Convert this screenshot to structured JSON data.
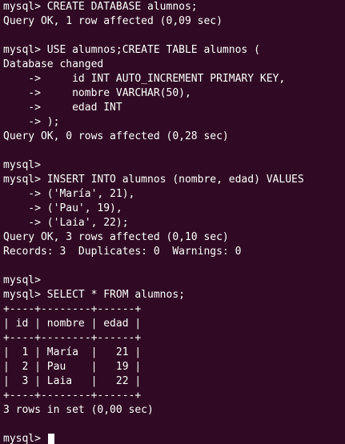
{
  "terminal": {
    "lines": [
      "mysql> CREATE DATABASE alumnos;",
      "Query OK, 1 row affected (0,09 sec)",
      "",
      "mysql> USE alumnos;CREATE TABLE alumnos (",
      "Database changed",
      "    ->     id INT AUTO_INCREMENT PRIMARY KEY,",
      "    ->     nombre VARCHAR(50),",
      "    ->     edad INT",
      "    -> );",
      "Query OK, 0 rows affected (0,28 sec)",
      "",
      "mysql>",
      "mysql> INSERT INTO alumnos (nombre, edad) VALUES",
      "    -> ('María', 21),",
      "    -> ('Pau', 19),",
      "    -> ('Laia', 22);",
      "Query OK, 3 rows affected (0,10 sec)",
      "Records: 3  Duplicates: 0  Warnings: 0",
      "",
      "mysql>",
      "mysql> SELECT * FROM alumnos;",
      "+----+--------+------+",
      "| id | nombre | edad |",
      "+----+--------+------+",
      "|  1 | María  |   21 |",
      "|  2 | Pau    |   19 |",
      "|  3 | Laia   |   22 |",
      "+----+--------+------+",
      "3 rows in set (0,00 sec)",
      ""
    ],
    "prompt": "mysql> "
  }
}
